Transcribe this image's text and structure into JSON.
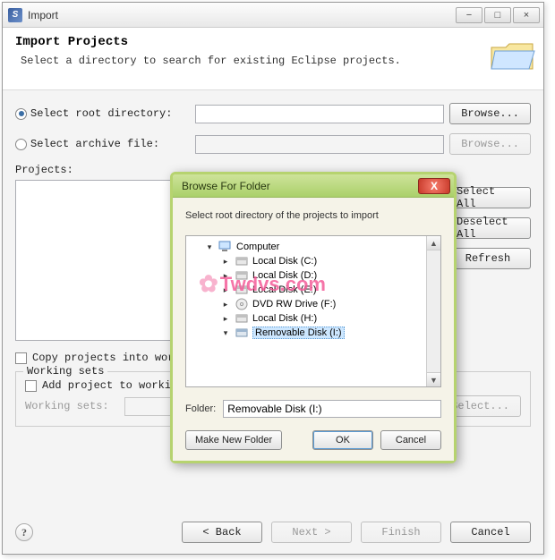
{
  "window": {
    "title": "Import",
    "controls": {
      "min": "−",
      "max": "□",
      "close": "×"
    }
  },
  "header": {
    "title": "Import Projects",
    "subtitle": "Select a directory to search for existing Eclipse projects."
  },
  "source": {
    "root_radio_label": "Select root directory:",
    "archive_radio_label": "Select archive file:",
    "root_value": "",
    "archive_value": "",
    "browse_label": "Browse...",
    "browse2_label": "Browse..."
  },
  "projects": {
    "label": "Projects:",
    "select_all": "Select All",
    "deselect_all": "Deselect All",
    "refresh": "Refresh"
  },
  "copy_checkbox": "Copy projects into workspace",
  "working_sets": {
    "legend": "Working sets",
    "add_checkbox": "Add project to working sets",
    "label": "Working sets:",
    "select_btn": "Select..."
  },
  "footer": {
    "back": "< Back",
    "next": "Next >",
    "finish": "Finish",
    "cancel": "Cancel"
  },
  "dialog": {
    "title": "Browse For Folder",
    "message": "Select root directory of the projects to import",
    "tree": [
      {
        "label": "Computer",
        "type": "computer",
        "level": 1,
        "expanded": true
      },
      {
        "label": "Local Disk (C:)",
        "type": "disk",
        "level": 2,
        "expanded": false
      },
      {
        "label": "Local Disk (D:)",
        "type": "disk",
        "level": 2,
        "expanded": false
      },
      {
        "label": "Local Disk (E:)",
        "type": "disk",
        "level": 2,
        "expanded": false
      },
      {
        "label": "DVD RW Drive (F:)",
        "type": "dvd",
        "level": 2,
        "expanded": false
      },
      {
        "label": "Local Disk (H:)",
        "type": "disk",
        "level": 2,
        "expanded": false
      },
      {
        "label": "Removable Disk (I:)",
        "type": "removable",
        "level": 2,
        "expanded": true,
        "selected": true
      }
    ],
    "folder_label": "Folder:",
    "folder_value": "Removable Disk (I:)",
    "make_new": "Make New Folder",
    "ok": "OK",
    "cancel": "Cancel"
  },
  "watermark": "Twdvs.com"
}
